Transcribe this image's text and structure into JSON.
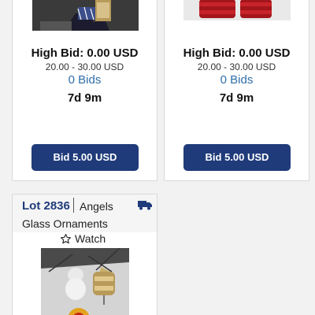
{
  "cards": [
    {
      "high_bid": "High Bid: 0.00 USD",
      "estimate": "20.00 - 30.00 USD",
      "bids": "0 Bids",
      "time_left": "7d 9m",
      "button": "Bid 5.00 USD"
    },
    {
      "high_bid": "High Bid: 0.00 USD",
      "estimate": "20.00 - 30.00 USD",
      "bids": "0 Bids",
      "time_left": "7d 9m",
      "button": "Bid 5.00 USD"
    }
  ],
  "lot": {
    "number": "Lot 2836",
    "title_line1": "Angels",
    "title_line2": "Glass Ornaments",
    "watch": "Watch",
    "shipping_icon": "truck-icon"
  },
  "colors": {
    "primary": "#1f3b7a",
    "link": "#2f6ea8",
    "background": "#f2f2f2"
  }
}
